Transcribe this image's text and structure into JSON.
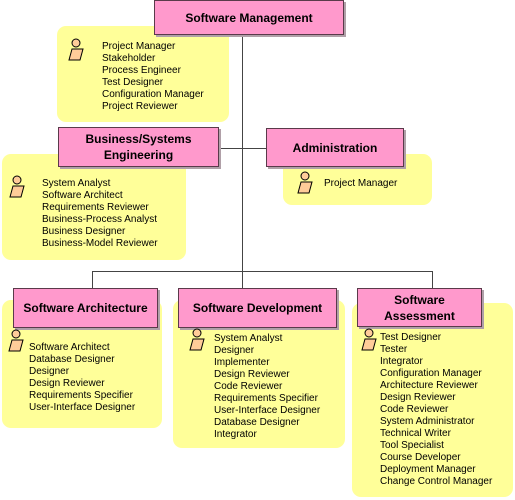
{
  "diagram": {
    "root": {
      "title": "Software Management",
      "roles": [
        "Project Manager",
        "Stakeholder",
        "Process Engineer",
        "Test Designer",
        "Configuration Manager",
        "Project Reviewer"
      ]
    },
    "business": {
      "title_line1": "Business/Systems",
      "title_line2": "Engineering",
      "roles": [
        "System Analyst",
        "Software Architect",
        "Requirements Reviewer",
        "Business-Process Analyst",
        "Business Designer",
        "Business-Model Reviewer"
      ]
    },
    "admin": {
      "title": "Administration",
      "roles": [
        "Project Manager"
      ]
    },
    "architecture": {
      "title": "Software Architecture",
      "roles": [
        "Software Architect",
        "Database Designer",
        "Designer",
        "Design Reviewer",
        "Requirements Specifier",
        "User-Interface Designer"
      ]
    },
    "development": {
      "title": "Software Development",
      "roles": [
        "System Analyst",
        "Designer",
        "Implementer",
        "Design Reviewer",
        "Code Reviewer",
        "Requirements Specifier",
        "User-Interface Designer",
        "Database Designer",
        "Integrator"
      ]
    },
    "assessment": {
      "title_line1": "Software",
      "title_line2": "Assessment",
      "roles": [
        "Test Designer",
        "Tester",
        "Integrator",
        "Configuration Manager",
        "Architecture Reviewer",
        "Design Reviewer",
        "Code Reviewer",
        "System Administrator",
        "Technical Writer",
        "Tool Specialist",
        "Course Developer",
        "Deployment Manager",
        "Change Control Manager"
      ]
    }
  },
  "colors": {
    "box": "#ff99cc",
    "note": "#ffff99",
    "actor": "#ffcc99"
  }
}
